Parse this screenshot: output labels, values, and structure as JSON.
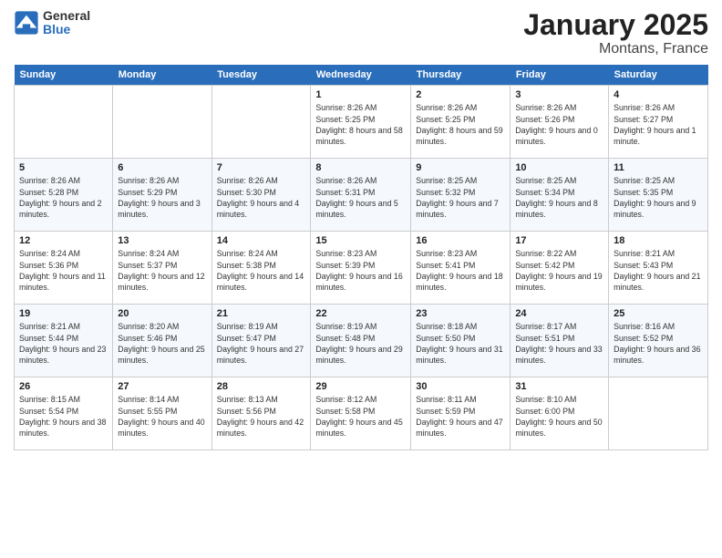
{
  "header": {
    "logo_general": "General",
    "logo_blue": "Blue",
    "month_title": "January 2025",
    "location": "Montans, France"
  },
  "days_of_week": [
    "Sunday",
    "Monday",
    "Tuesday",
    "Wednesday",
    "Thursday",
    "Friday",
    "Saturday"
  ],
  "weeks": [
    [
      {
        "day": "",
        "info": ""
      },
      {
        "day": "",
        "info": ""
      },
      {
        "day": "",
        "info": ""
      },
      {
        "day": "1",
        "sunrise": "8:26 AM",
        "sunset": "5:25 PM",
        "daylight": "8 hours and 58 minutes."
      },
      {
        "day": "2",
        "sunrise": "8:26 AM",
        "sunset": "5:25 PM",
        "daylight": "8 hours and 59 minutes."
      },
      {
        "day": "3",
        "sunrise": "8:26 AM",
        "sunset": "5:26 PM",
        "daylight": "9 hours and 0 minutes."
      },
      {
        "day": "4",
        "sunrise": "8:26 AM",
        "sunset": "5:27 PM",
        "daylight": "9 hours and 1 minute."
      }
    ],
    [
      {
        "day": "5",
        "sunrise": "8:26 AM",
        "sunset": "5:28 PM",
        "daylight": "9 hours and 2 minutes."
      },
      {
        "day": "6",
        "sunrise": "8:26 AM",
        "sunset": "5:29 PM",
        "daylight": "9 hours and 3 minutes."
      },
      {
        "day": "7",
        "sunrise": "8:26 AM",
        "sunset": "5:30 PM",
        "daylight": "9 hours and 4 minutes."
      },
      {
        "day": "8",
        "sunrise": "8:26 AM",
        "sunset": "5:31 PM",
        "daylight": "9 hours and 5 minutes."
      },
      {
        "day": "9",
        "sunrise": "8:25 AM",
        "sunset": "5:32 PM",
        "daylight": "9 hours and 7 minutes."
      },
      {
        "day": "10",
        "sunrise": "8:25 AM",
        "sunset": "5:34 PM",
        "daylight": "9 hours and 8 minutes."
      },
      {
        "day": "11",
        "sunrise": "8:25 AM",
        "sunset": "5:35 PM",
        "daylight": "9 hours and 9 minutes."
      }
    ],
    [
      {
        "day": "12",
        "sunrise": "8:24 AM",
        "sunset": "5:36 PM",
        "daylight": "9 hours and 11 minutes."
      },
      {
        "day": "13",
        "sunrise": "8:24 AM",
        "sunset": "5:37 PM",
        "daylight": "9 hours and 12 minutes."
      },
      {
        "day": "14",
        "sunrise": "8:24 AM",
        "sunset": "5:38 PM",
        "daylight": "9 hours and 14 minutes."
      },
      {
        "day": "15",
        "sunrise": "8:23 AM",
        "sunset": "5:39 PM",
        "daylight": "9 hours and 16 minutes."
      },
      {
        "day": "16",
        "sunrise": "8:23 AM",
        "sunset": "5:41 PM",
        "daylight": "9 hours and 18 minutes."
      },
      {
        "day": "17",
        "sunrise": "8:22 AM",
        "sunset": "5:42 PM",
        "daylight": "9 hours and 19 minutes."
      },
      {
        "day": "18",
        "sunrise": "8:21 AM",
        "sunset": "5:43 PM",
        "daylight": "9 hours and 21 minutes."
      }
    ],
    [
      {
        "day": "19",
        "sunrise": "8:21 AM",
        "sunset": "5:44 PM",
        "daylight": "9 hours and 23 minutes."
      },
      {
        "day": "20",
        "sunrise": "8:20 AM",
        "sunset": "5:46 PM",
        "daylight": "9 hours and 25 minutes."
      },
      {
        "day": "21",
        "sunrise": "8:19 AM",
        "sunset": "5:47 PM",
        "daylight": "9 hours and 27 minutes."
      },
      {
        "day": "22",
        "sunrise": "8:19 AM",
        "sunset": "5:48 PM",
        "daylight": "9 hours and 29 minutes."
      },
      {
        "day": "23",
        "sunrise": "8:18 AM",
        "sunset": "5:50 PM",
        "daylight": "9 hours and 31 minutes."
      },
      {
        "day": "24",
        "sunrise": "8:17 AM",
        "sunset": "5:51 PM",
        "daylight": "9 hours and 33 minutes."
      },
      {
        "day": "25",
        "sunrise": "8:16 AM",
        "sunset": "5:52 PM",
        "daylight": "9 hours and 36 minutes."
      }
    ],
    [
      {
        "day": "26",
        "sunrise": "8:15 AM",
        "sunset": "5:54 PM",
        "daylight": "9 hours and 38 minutes."
      },
      {
        "day": "27",
        "sunrise": "8:14 AM",
        "sunset": "5:55 PM",
        "daylight": "9 hours and 40 minutes."
      },
      {
        "day": "28",
        "sunrise": "8:13 AM",
        "sunset": "5:56 PM",
        "daylight": "9 hours and 42 minutes."
      },
      {
        "day": "29",
        "sunrise": "8:12 AM",
        "sunset": "5:58 PM",
        "daylight": "9 hours and 45 minutes."
      },
      {
        "day": "30",
        "sunrise": "8:11 AM",
        "sunset": "5:59 PM",
        "daylight": "9 hours and 47 minutes."
      },
      {
        "day": "31",
        "sunrise": "8:10 AM",
        "sunset": "6:00 PM",
        "daylight": "9 hours and 50 minutes."
      },
      {
        "day": "",
        "info": ""
      }
    ]
  ],
  "labels": {
    "sunrise": "Sunrise:",
    "sunset": "Sunset:",
    "daylight": "Daylight:"
  }
}
